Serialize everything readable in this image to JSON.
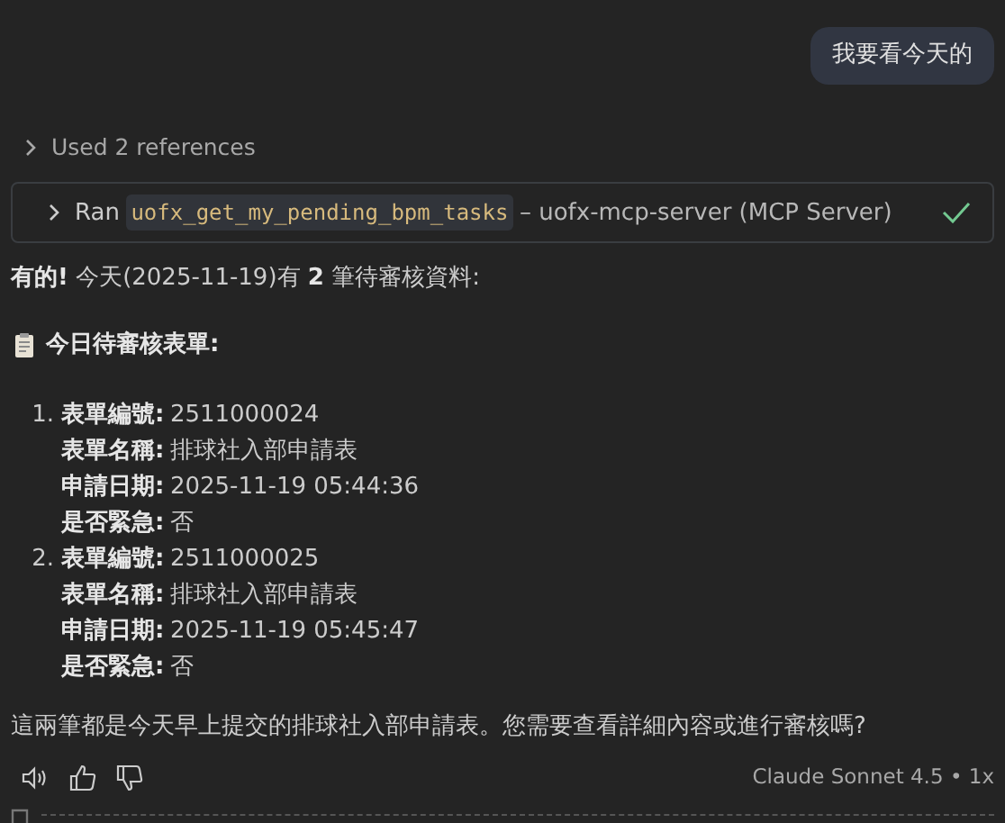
{
  "user_message": "我要看今天的",
  "references": {
    "label": "Used 2 references",
    "expanded": false
  },
  "tool_call": {
    "prefix": "Ran",
    "tool": "uofx_get_my_pending_bpm_tasks",
    "suffix": "– uofx-mcp-server (MCP Server)",
    "expanded": false,
    "done": true
  },
  "response": {
    "summary": "**有的!** 今天(2025-11-19)有 **2** 筆待審核資料:",
    "heading": "今日待審核表單:",
    "forms": [
      {
        "number": "1.",
        "fields": [
          {
            "label": "表單編號:",
            "value": "2511000024"
          },
          {
            "label": "表單名稱:",
            "value": "排球社入部申請表"
          },
          {
            "label": "申請日期:",
            "value": "2025-11-19 05:44:36"
          },
          {
            "label": "是否緊急:",
            "value": "否"
          }
        ]
      },
      {
        "number": "2.",
        "fields": [
          {
            "label": "表單編號:",
            "value": "2511000025"
          },
          {
            "label": "表單名稱:",
            "value": "排球社入部申請表"
          },
          {
            "label": "申請日期:",
            "value": "2025-11-19 05:45:47"
          },
          {
            "label": "是否緊急:",
            "value": "否"
          }
        ]
      }
    ],
    "closing": "這兩筆都是今天早上提交的排球社入部申請表。您需要查看詳細內容或進行審核嗎?"
  },
  "footer": {
    "model": "Claude Sonnet 4.5 • 1x"
  }
}
